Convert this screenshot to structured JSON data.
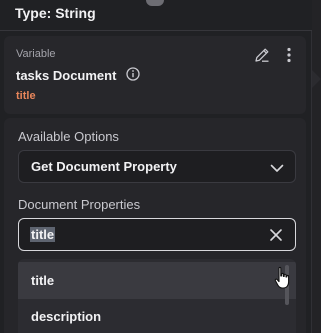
{
  "header": {
    "type_label": "Type: String"
  },
  "variable": {
    "section_label": "Variable",
    "name": "tasks Document",
    "property": "title",
    "icons": [
      "info-icon",
      "edit-icon",
      "more-vert-icon"
    ]
  },
  "available_options": {
    "label": "Available Options",
    "selected": "Get Document Property",
    "icon": "chevron-down-icon"
  },
  "document_properties": {
    "label": "Document Properties",
    "input_value": "title",
    "clear_icon": "close-icon",
    "options": [
      {
        "label": "title"
      },
      {
        "label": "description"
      }
    ]
  },
  "colors": {
    "accent_orange": "#e8865b",
    "panel_bg": "#202124",
    "card_bg": "#26262a",
    "text_primary": "#f2f2f4"
  }
}
